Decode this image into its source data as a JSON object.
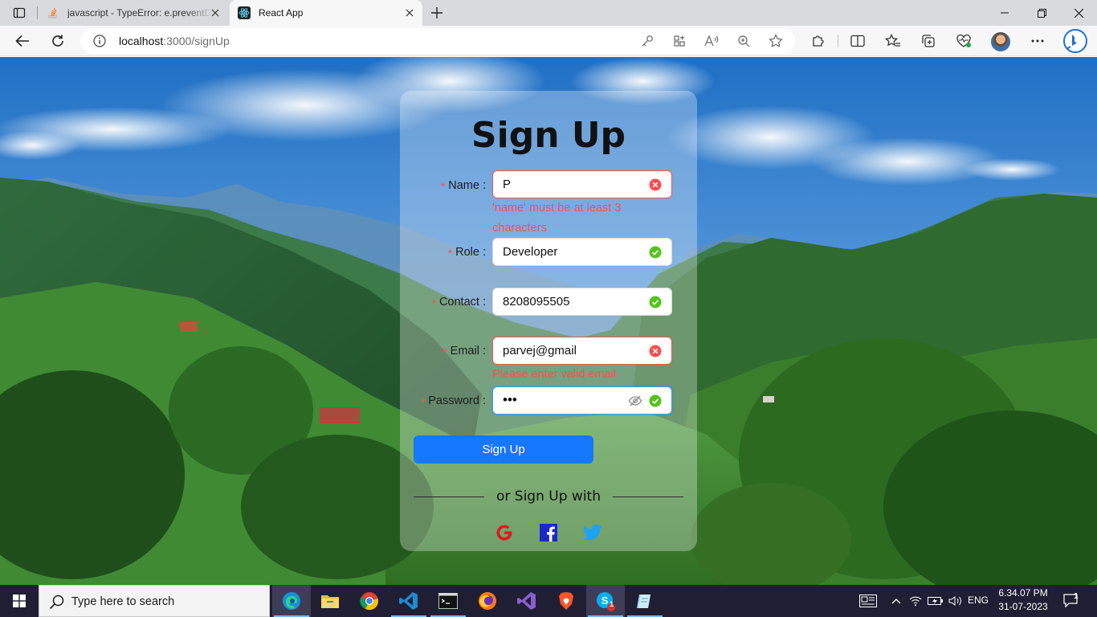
{
  "browser": {
    "tabs": [
      {
        "title": "javascript - TypeError: e.preventDefault is not a function",
        "icon": "stackoverflow-icon",
        "active": false
      },
      {
        "title": "React App",
        "icon": "react-icon",
        "active": true
      }
    ],
    "address": {
      "host": "localhost",
      "path": ":3000/signUp"
    }
  },
  "form": {
    "title": "Sign Up",
    "fields": [
      {
        "label": "Name",
        "value": "P",
        "status": "error",
        "error": "'name' must be at least 3 characters"
      },
      {
        "label": "Role",
        "value": "Developer",
        "status": "success"
      },
      {
        "label": "Contact",
        "value": "8208095505",
        "status": "success"
      },
      {
        "label": "Email",
        "value": "parvej@gmail",
        "status": "error",
        "error": "Please enter valid email"
      },
      {
        "label": "Password",
        "value": "•••",
        "status": "success"
      }
    ],
    "submit_label": "Sign Up",
    "alt_label": "or Sign Up with",
    "social": [
      "google-icon",
      "facebook-icon",
      "twitter-icon"
    ]
  },
  "taskbar": {
    "search_placeholder": "Type here to search",
    "apps": [
      "edge-icon",
      "file-explorer-icon",
      "chrome-icon",
      "vscode-icon",
      "terminal-icon",
      "firefox-icon",
      "visual-studio-icon",
      "brave-icon",
      "skype-icon",
      "notepad-icon"
    ],
    "skype_badge": "1",
    "language": "ENG",
    "time": "6.34.07 PM",
    "date": "31-07-2023",
    "notification_count": "1"
  },
  "colors": {
    "primary": "#1677ff",
    "error": "#ff4d4f",
    "success": "#52c41a",
    "taskbar": "#1f1e33"
  }
}
